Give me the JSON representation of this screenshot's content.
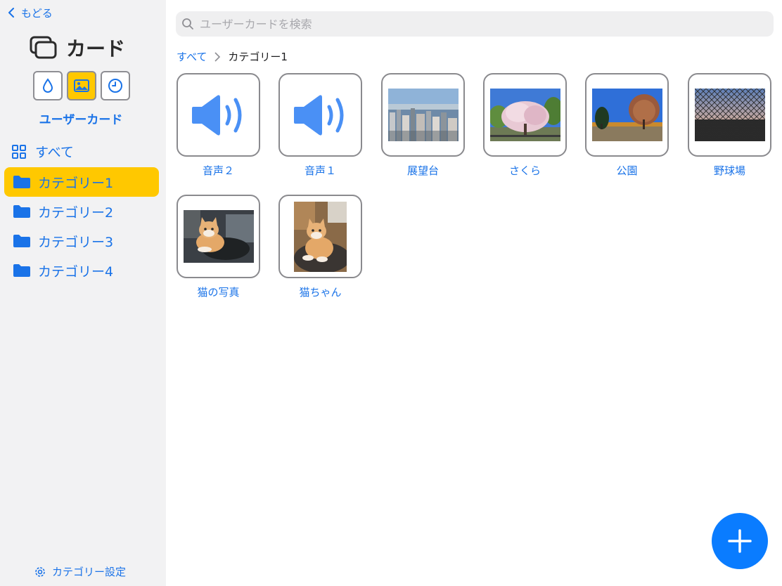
{
  "sidebar": {
    "back_label": "もどる",
    "app_title": "カード",
    "modes": [
      {
        "icon": "drop-icon",
        "active": false
      },
      {
        "icon": "image-icon",
        "active": true
      },
      {
        "icon": "clock-icon",
        "active": false
      }
    ],
    "mode_label": "ユーザーカード",
    "all_label": "すべて",
    "categories": [
      {
        "label": "カテゴリー1",
        "selected": true
      },
      {
        "label": "カテゴリー2",
        "selected": false
      },
      {
        "label": "カテゴリー3",
        "selected": false
      },
      {
        "label": "カテゴリー4",
        "selected": false
      }
    ],
    "settings_label": "カテゴリー設定"
  },
  "search": {
    "placeholder": "ユーザーカードを検索",
    "value": ""
  },
  "breadcrumb": {
    "root": "すべて",
    "current": "カテゴリー1"
  },
  "cards": [
    {
      "label": "音声２",
      "type": "audio"
    },
    {
      "label": "音声１",
      "type": "audio"
    },
    {
      "label": "展望台",
      "type": "photo",
      "scene": "city-skyline"
    },
    {
      "label": "さくら",
      "type": "photo",
      "scene": "cherry-blossom"
    },
    {
      "label": "公園",
      "type": "photo",
      "scene": "park-trees"
    },
    {
      "label": "野球場",
      "type": "photo",
      "scene": "baseball-fence"
    },
    {
      "label": "猫の写真",
      "type": "photo",
      "scene": "cat-lying"
    },
    {
      "label": "猫ちゃん",
      "type": "photo",
      "scene": "cat-sitting"
    }
  ],
  "colors": {
    "accent": "#1a73e8",
    "selected": "#ffc800",
    "fab": "#0a7cff",
    "sidebar_bg": "#f2f2f3"
  }
}
